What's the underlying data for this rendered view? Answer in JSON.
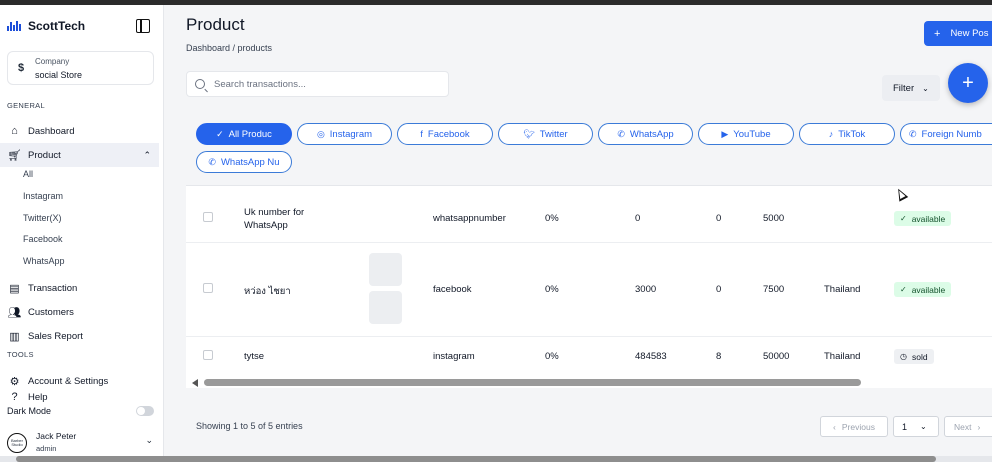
{
  "brand": {
    "name": "ScottTech"
  },
  "company": {
    "label": "Company",
    "name": "social Store",
    "icon": "$"
  },
  "sidebar": {
    "general_label": "GENERAL",
    "tools_label": "TOOLS",
    "items": [
      {
        "label": "Dashboard",
        "icon": "home-icon"
      },
      {
        "label": "Product",
        "icon": "cart-icon"
      },
      {
        "label": "Transaction",
        "icon": "document-icon"
      },
      {
        "label": "Customers",
        "icon": "users-icon"
      },
      {
        "label": "Sales Report",
        "icon": "chart-icon"
      }
    ],
    "product_sub": [
      "All",
      "Instagram",
      "Twitter(X)",
      "Facebook",
      "WhatsApp"
    ],
    "tools": [
      {
        "label": "Account & Settings",
        "icon": "gear-icon"
      },
      {
        "label": "Help",
        "icon": "help-icon"
      }
    ],
    "dark_mode_label": "Dark Mode",
    "user": {
      "name": "Jack Peter",
      "role": "admin",
      "avatar_text": "Barber Studio"
    }
  },
  "header": {
    "title": "Product",
    "breadcrumb": "Dashboard  /  products",
    "new_post_label": "New Pos"
  },
  "search": {
    "placeholder": "Search transactions..."
  },
  "filter": {
    "label": "Filter"
  },
  "pills": [
    {
      "label": "All Produc",
      "icon": "check-icon",
      "active": true
    },
    {
      "label": "Instagram",
      "icon": "instagram-icon"
    },
    {
      "label": "Facebook",
      "icon": "facebook-icon"
    },
    {
      "label": "Twitter",
      "icon": "twitter-icon"
    },
    {
      "label": "WhatsApp",
      "icon": "whatsapp-icon"
    },
    {
      "label": "YouTube",
      "icon": "youtube-icon"
    },
    {
      "label": "TikTok",
      "icon": "tiktok-icon"
    },
    {
      "label": "Foreign Numb",
      "icon": "phone-icon"
    },
    {
      "label": "WhatsApp Nu",
      "icon": "whatsapp-icon"
    }
  ],
  "table": {
    "rows": [
      {
        "name": "Uk number for WhatsApp",
        "platform": "whatsappnumber",
        "pct": "0%",
        "v1": "0",
        "v2": "0",
        "price": "5000",
        "country": "",
        "status": "available"
      },
      {
        "name": "หว่อง ไชยา",
        "platform": "facebook",
        "pct": "0%",
        "v1": "3000",
        "v2": "0",
        "price": "7500",
        "country": "Thailand",
        "status": "available"
      },
      {
        "name": "tytse",
        "platform": "instagram",
        "pct": "0%",
        "v1": "484583",
        "v2": "8",
        "price": "50000",
        "country": "Thailand",
        "status": "sold"
      }
    ]
  },
  "footer": {
    "entries": "Showing 1 to 5 of 5 entries",
    "previous": "Previous",
    "page": "1",
    "next": "Next"
  }
}
